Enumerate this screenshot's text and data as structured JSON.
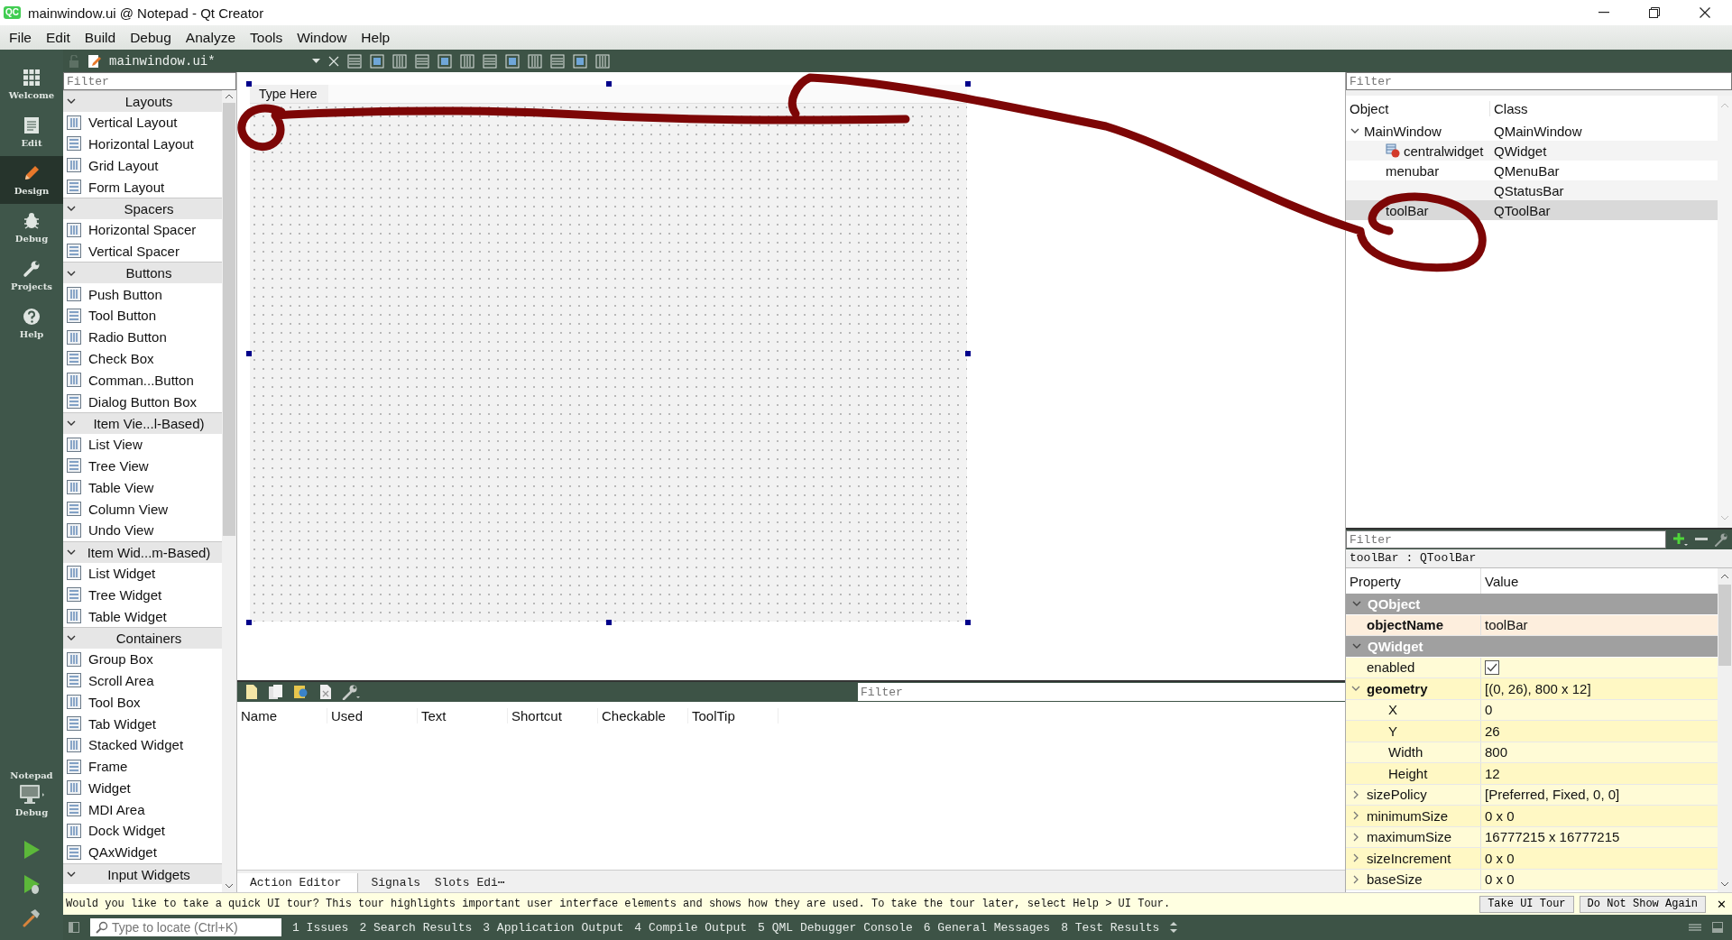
{
  "window": {
    "logo": "QC",
    "title": "mainwindow.ui @ Notepad - Qt Creator"
  },
  "menu": [
    "File",
    "Edit",
    "Build",
    "Debug",
    "Analyze",
    "Tools",
    "Window",
    "Help"
  ],
  "editor_toolbar": {
    "document": "mainwindow.ui*"
  },
  "modes": [
    {
      "label": "Welcome",
      "selected": false
    },
    {
      "label": "Edit",
      "selected": false
    },
    {
      "label": "Design",
      "selected": true
    },
    {
      "label": "Debug",
      "selected": false
    },
    {
      "label": "Projects",
      "selected": false
    },
    {
      "label": "Help",
      "selected": false
    }
  ],
  "kit": {
    "project": "Notepad",
    "config": "Debug"
  },
  "widget_box": {
    "filter_placeholder": "Filter",
    "categories": [
      {
        "title": "Layouts",
        "expanded": true,
        "items": [
          "Vertical Layout",
          "Horizontal Layout",
          "Grid Layout",
          "Form Layout"
        ]
      },
      {
        "title": "Spacers",
        "expanded": true,
        "items": [
          "Horizontal Spacer",
          "Vertical Spacer"
        ]
      },
      {
        "title": "Buttons",
        "expanded": true,
        "items": [
          "Push Button",
          "Tool Button",
          "Radio Button",
          "Check Box",
          "Comman...Button",
          "Dialog Button Box"
        ]
      },
      {
        "title": "Item Vie...l-Based)",
        "expanded": true,
        "items": [
          "List View",
          "Tree View",
          "Table View",
          "Column View",
          "Undo View"
        ]
      },
      {
        "title": "Item Wid...m-Based)",
        "expanded": true,
        "items": [
          "List Widget",
          "Tree Widget",
          "Table Widget"
        ]
      },
      {
        "title": "Containers",
        "expanded": true,
        "items": [
          "Group Box",
          "Scroll Area",
          "Tool Box",
          "Tab Widget",
          "Stacked Widget",
          "Frame",
          "Widget",
          "MDI Area",
          "Dock Widget",
          "QAxWidget"
        ]
      },
      {
        "title": "Input Widgets",
        "expanded": true
      }
    ]
  },
  "form": {
    "menu_placeholder": "Type Here"
  },
  "action_editor": {
    "filter_placeholder": "Filter",
    "columns": [
      "Name",
      "Used",
      "Text",
      "Shortcut",
      "Checkable",
      "ToolTip"
    ],
    "tabs": [
      {
        "label": "Action Editor",
        "selected": true
      },
      {
        "label": "Signals  Slots Edi⋯",
        "selected": false
      }
    ]
  },
  "object_inspector": {
    "filter_placeholder": "Filter",
    "columns": [
      "Object",
      "Class"
    ],
    "tree": [
      {
        "object": "MainWindow",
        "class": "QMainWindow",
        "expanded": true,
        "selected": false,
        "children": [
          {
            "object": "centralwidget",
            "class": "QWidget",
            "selected": false,
            "kind": "widget"
          },
          {
            "object": "menubar",
            "class": "QMenuBar",
            "selected": false
          },
          {
            "class": "QStatusBar",
            "selected": false
          },
          {
            "object": "toolBar",
            "class": "QToolBar",
            "selected": true
          }
        ]
      }
    ]
  },
  "property_editor": {
    "filter_placeholder": "Filter",
    "context": "toolBar : QToolBar",
    "columns": [
      "Property",
      "Value"
    ],
    "groups": [
      {
        "name": "QObject",
        "expanded": true,
        "properties": [
          {
            "name": "objectName",
            "value": "toolBar",
            "changed": true
          }
        ]
      },
      {
        "name": "QWidget",
        "expanded": true,
        "properties": [
          {
            "name": "enabled",
            "kind": "checkbox",
            "checked": true,
            "changed": false
          },
          {
            "name": "geometry",
            "value": "[(0, 26), 800 x 12]",
            "changed": true,
            "expanded": true,
            "children": [
              {
                "name": "X",
                "value": "0",
                "changed": false
              },
              {
                "name": "Y",
                "value": "26",
                "changed": false
              },
              {
                "name": "Width",
                "value": "800",
                "changed": false
              },
              {
                "name": "Height",
                "value": "12",
                "changed": false
              }
            ]
          },
          {
            "name": "sizePolicy",
            "value": "[Preferred, Fixed, 0, 0]",
            "changed": false,
            "expanded": false
          },
          {
            "name": "minimumSize",
            "value": "0 x 0",
            "changed": false,
            "expanded": false
          },
          {
            "name": "maximumSize",
            "value": "16777215 x 16777215",
            "changed": false,
            "expanded": false
          },
          {
            "name": "sizeIncrement",
            "value": "0 x 0",
            "changed": false,
            "expanded": false
          },
          {
            "name": "baseSize",
            "value": "0 x 0",
            "changed": false,
            "expanded": false
          }
        ]
      }
    ]
  },
  "tour_bar": {
    "message": "Would you like to take a quick UI tour? This tour highlights important user interface elements and shows how they are used. To take the tour later, select Help > UI Tour.",
    "buttons": [
      "Take UI Tour",
      "Do Not Show Again"
    ],
    "close": "✕"
  },
  "status_bar": {
    "locate_placeholder": "Type to locate (Ctrl+K)",
    "panes": [
      "1 Issues",
      "2 Search Results",
      "3 Application Output",
      "4 Compile Output",
      "5 QML Debugger Console",
      "6 General Messages",
      "8 Test Results"
    ]
  }
}
